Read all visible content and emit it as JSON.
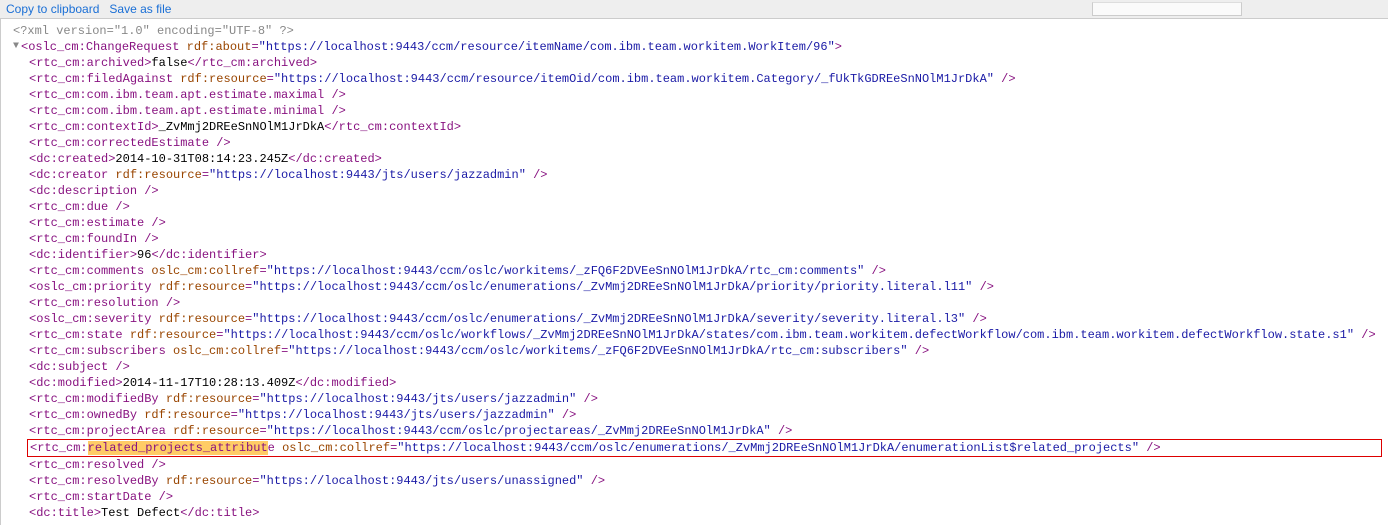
{
  "toolbar": {
    "copy": "Copy to clipboard",
    "save": "Save as file"
  },
  "xml": {
    "pi": "<?xml version=\"1.0\" encoding=\"UTF-8\" ?>",
    "root": {
      "name": "oslc_cm:ChangeRequest",
      "attr": "rdf:about",
      "val": "https://localhost:9443/ccm/resource/itemName/com.ibm.team.workitem.WorkItem/96"
    },
    "lines": [
      {
        "tag": "rtc_cm:archived",
        "text": "false"
      },
      {
        "tag": "rtc_cm:filedAgainst",
        "attr": "rdf:resource",
        "val": "https://localhost:9443/ccm/resource/itemOid/com.ibm.team.workitem.Category/_fUkTkGDREeSnNOlM1JrDkA",
        "self": true
      },
      {
        "tag": "rtc_cm:com.ibm.team.apt.estimate.maximal",
        "self": true
      },
      {
        "tag": "rtc_cm:com.ibm.team.apt.estimate.minimal",
        "self": true
      },
      {
        "tag": "rtc_cm:contextId",
        "text": "_ZvMmj2DREeSnNOlM1JrDkA"
      },
      {
        "tag": "rtc_cm:correctedEstimate",
        "self": true
      },
      {
        "tag": "dc:created",
        "text": "2014-10-31T08:14:23.245Z"
      },
      {
        "tag": "dc:creator",
        "attr": "rdf:resource",
        "val": "https://localhost:9443/jts/users/jazzadmin",
        "self": true
      },
      {
        "tag": "dc:description",
        "self": true
      },
      {
        "tag": "rtc_cm:due",
        "self": true
      },
      {
        "tag": "rtc_cm:estimate",
        "self": true
      },
      {
        "tag": "rtc_cm:foundIn",
        "self": true
      },
      {
        "tag": "dc:identifier",
        "text": "96"
      },
      {
        "tag": "rtc_cm:comments",
        "attr": "oslc_cm:collref",
        "val": "https://localhost:9443/ccm/oslc/workitems/_zFQ6F2DVEeSnNOlM1JrDkA/rtc_cm:comments",
        "self": true
      },
      {
        "tag": "oslc_cm:priority",
        "attr": "rdf:resource",
        "val": "https://localhost:9443/ccm/oslc/enumerations/_ZvMmj2DREeSnNOlM1JrDkA/priority/priority.literal.l11",
        "self": true
      },
      {
        "tag": "rtc_cm:resolution",
        "self": true
      },
      {
        "tag": "oslc_cm:severity",
        "attr": "rdf:resource",
        "val": "https://localhost:9443/ccm/oslc/enumerations/_ZvMmj2DREeSnNOlM1JrDkA/severity/severity.literal.l3",
        "self": true
      },
      {
        "tag": "rtc_cm:state",
        "attr": "rdf:resource",
        "val": "https://localhost:9443/ccm/oslc/workflows/_ZvMmj2DREeSnNOlM1JrDkA/states/com.ibm.team.workitem.defectWorkflow/com.ibm.team.workitem.defectWorkflow.state.s1",
        "self": true
      },
      {
        "tag": "rtc_cm:subscribers",
        "attr": "oslc_cm:collref",
        "val": "https://localhost:9443/ccm/oslc/workitems/_zFQ6F2DVEeSnNOlM1JrDkA/rtc_cm:subscribers",
        "self": true
      },
      {
        "tag": "dc:subject",
        "self": true
      },
      {
        "tag": "dc:modified",
        "text": "2014-11-17T10:28:13.409Z"
      },
      {
        "tag": "rtc_cm:modifiedBy",
        "attr": "rdf:resource",
        "val": "https://localhost:9443/jts/users/jazzadmin",
        "self": true
      },
      {
        "tag": "rtc_cm:ownedBy",
        "attr": "rdf:resource",
        "val": "https://localhost:9443/jts/users/jazzadmin",
        "self": true
      },
      {
        "tag": "rtc_cm:projectArea",
        "attr": "rdf:resource",
        "val": "https://localhost:9443/ccm/oslc/projectareas/_ZvMmj2DREeSnNOlM1JrDkA",
        "self": true,
        "pass_box": true
      }
    ],
    "boxed": {
      "prefix": "rtc_cm:",
      "tagpart": "related_projects_attribut",
      "tagtail": "e",
      "attr": "oslc_cm:collref",
      "val": "https://localhost:9443/ccm/oslc/enumerations/_ZvMmj2DREeSnNOlM1JrDkA/enumerationList$related_projects"
    },
    "after": [
      {
        "tag": "rtc_cm:resolved",
        "self": true
      },
      {
        "tag": "rtc_cm:resolvedBy",
        "attr": "rdf:resource",
        "val": "https://localhost:9443/jts/users/unassigned",
        "self": true
      },
      {
        "tag": "rtc_cm:startDate",
        "self": true
      },
      {
        "tag": "dc:title",
        "text": "Test Defect"
      }
    ]
  }
}
